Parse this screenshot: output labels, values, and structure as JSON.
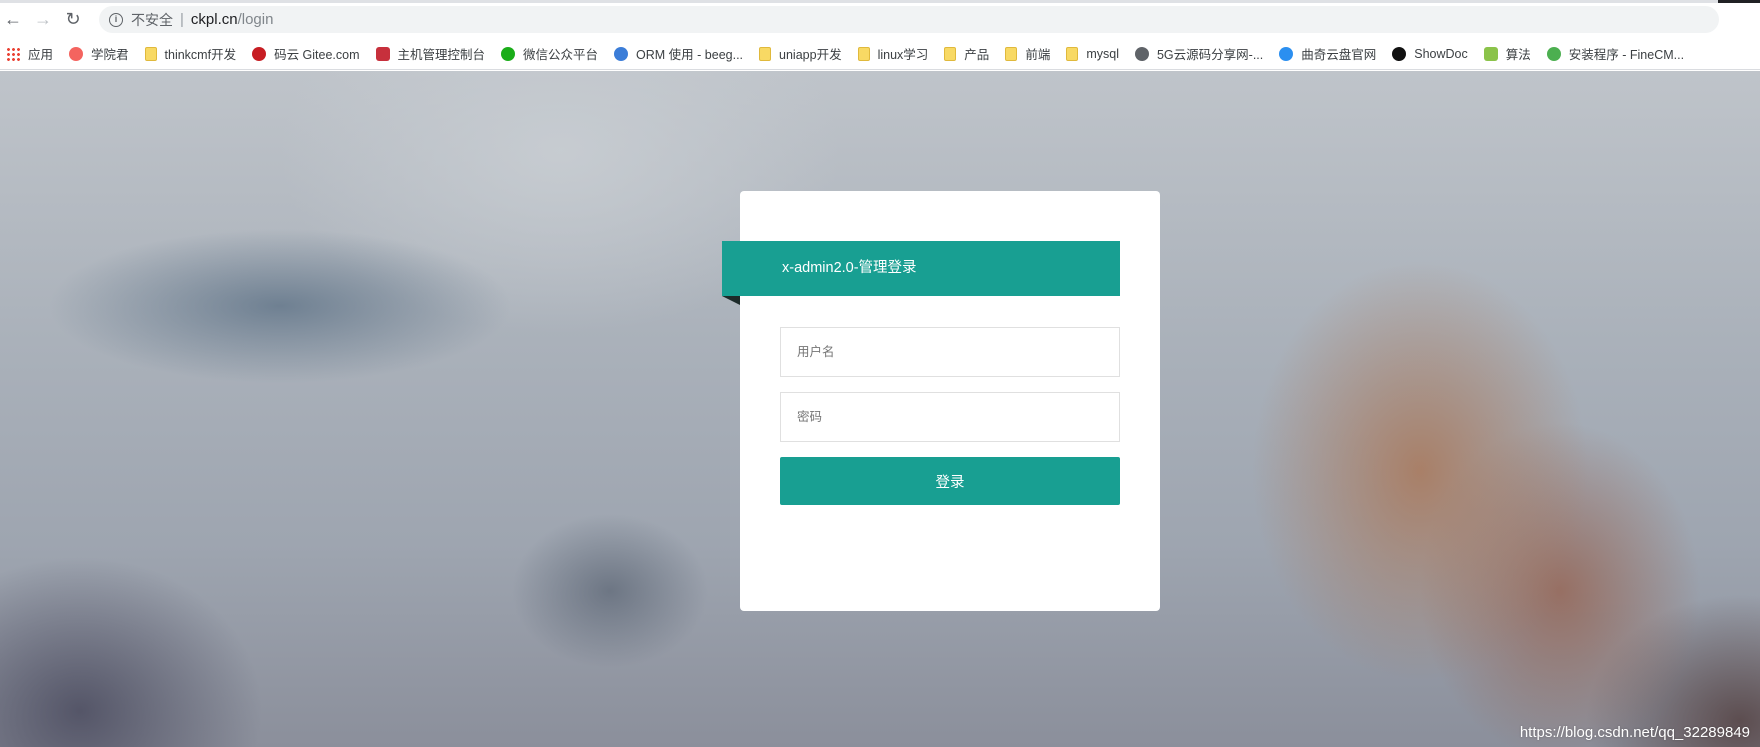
{
  "browser": {
    "security_label": "不安全",
    "url_host": "ckpl.cn",
    "url_path": "/login"
  },
  "bookmarks": [
    {
      "label": "应用",
      "icon": "apps-grid-icon",
      "color": "#ea4335"
    },
    {
      "label": "学院君",
      "icon": "laravel-icon",
      "color": "#f4645f"
    },
    {
      "label": "thinkcmf开发",
      "icon": "folder-icon",
      "color": "#f8d964"
    },
    {
      "label": "码云 Gitee.com",
      "icon": "gitee-icon",
      "color": "#c71d23"
    },
    {
      "label": "主机管理控制台",
      "icon": "diamond-icon",
      "color": "#c7303c"
    },
    {
      "label": "微信公众平台",
      "icon": "wechat-icon",
      "color": "#1aad19"
    },
    {
      "label": "ORM 使用 - beeg...",
      "icon": "beego-icon",
      "color": "#3b7dd8"
    },
    {
      "label": "uniapp开发",
      "icon": "folder-icon",
      "color": "#f8d964"
    },
    {
      "label": "linux学习",
      "icon": "folder-icon",
      "color": "#f8d964"
    },
    {
      "label": "产品",
      "icon": "folder-icon",
      "color": "#f8d964"
    },
    {
      "label": "前端",
      "icon": "folder-icon",
      "color": "#f8d964"
    },
    {
      "label": "mysql",
      "icon": "folder-icon",
      "color": "#f8d964"
    },
    {
      "label": "5G云源码分享网-...",
      "icon": "globe-icon",
      "color": "#5f6368"
    },
    {
      "label": "曲奇云盘官网",
      "icon": "cloud-icon",
      "color": "#2b8ff0"
    },
    {
      "label": "ShowDoc",
      "icon": "showdoc-icon",
      "color": "#111111"
    },
    {
      "label": "算法",
      "icon": "leetcode-icon",
      "color": "#8bc34a"
    },
    {
      "label": "安装程序 - FineCM...",
      "icon": "finecms-icon",
      "color": "#4caf50"
    }
  ],
  "login": {
    "title": "x-admin2.0-管理登录",
    "username_placeholder": "用户名",
    "password_placeholder": "密码",
    "submit_label": "登录"
  },
  "watermark": "https://blog.csdn.net/qq_32289849",
  "colors": {
    "accent": "#189f92"
  }
}
